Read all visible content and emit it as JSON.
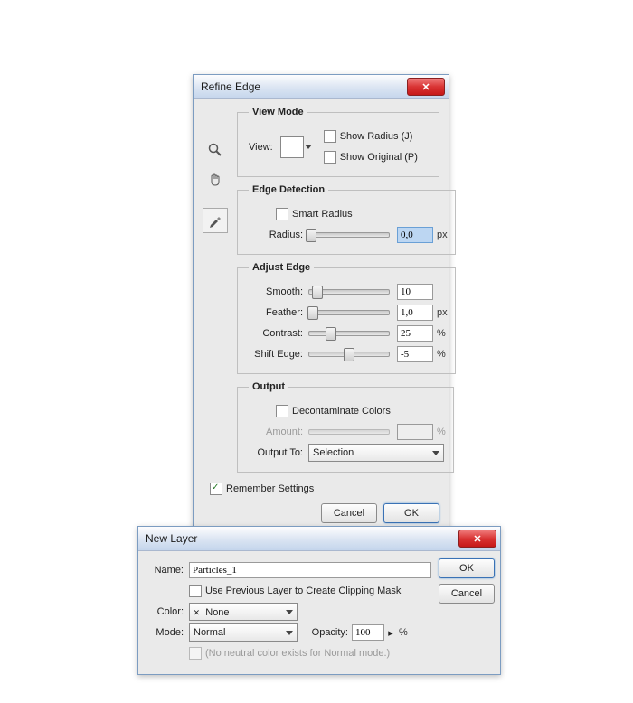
{
  "refine": {
    "title": "Refine Edge",
    "sections": {
      "viewmode": {
        "legend": "View Mode",
        "view_label": "View:",
        "show_radius": "Show Radius (J)",
        "show_original": "Show Original (P)"
      },
      "edge": {
        "legend": "Edge Detection",
        "smart": "Smart Radius",
        "radius_label": "Radius:",
        "radius_val": "0,0",
        "radius_unit": "px"
      },
      "adjust": {
        "legend": "Adjust Edge",
        "smooth_label": "Smooth:",
        "smooth_val": "10",
        "feather_label": "Feather:",
        "feather_val": "1,0",
        "feather_unit": "px",
        "contrast_label": "Contrast:",
        "contrast_val": "25",
        "contrast_unit": "%",
        "shift_label": "Shift Edge:",
        "shift_val": "-5",
        "shift_unit": "%"
      },
      "output": {
        "legend": "Output",
        "decon": "Decontaminate Colors",
        "amount_label": "Amount:",
        "amount_unit": "%",
        "outto_label": "Output To:",
        "outto_val": "Selection"
      }
    },
    "remember": "Remember Settings",
    "cancel": "Cancel",
    "ok": "OK"
  },
  "newlayer": {
    "title": "New Layer",
    "name_label": "Name:",
    "name_val": "Particles_1",
    "clip": "Use Previous Layer to Create Clipping Mask",
    "color_label": "Color:",
    "color_val": "None",
    "mode_label": "Mode:",
    "mode_val": "Normal",
    "opacity_label": "Opacity:",
    "opacity_val": "100",
    "opacity_unit": "%",
    "neutral": "(No neutral color exists for Normal mode.)",
    "ok": "OK",
    "cancel": "Cancel"
  }
}
